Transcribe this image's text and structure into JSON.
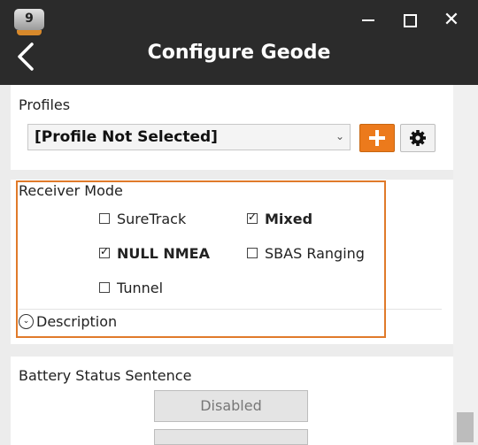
{
  "window": {
    "app_icon_label": "9",
    "title": "Configure Geode"
  },
  "profiles": {
    "label": "Profiles",
    "selected": "[Profile Not Selected]"
  },
  "receiver_mode": {
    "label": "Receiver Mode",
    "options": [
      {
        "label": "SureTrack",
        "checked": false
      },
      {
        "label": "Mixed",
        "checked": true
      },
      {
        "label": "NULL NMEA",
        "checked": true
      },
      {
        "label": "SBAS Ranging",
        "checked": false
      },
      {
        "label": "Tunnel",
        "checked": false
      }
    ],
    "description_label": "Description"
  },
  "battery": {
    "label": "Battery Status Sentence",
    "button_label": "Disabled"
  },
  "colors": {
    "accent": "#ec7a1c",
    "titlebar": "#2b2b2b",
    "highlight": "#e07a2a"
  }
}
